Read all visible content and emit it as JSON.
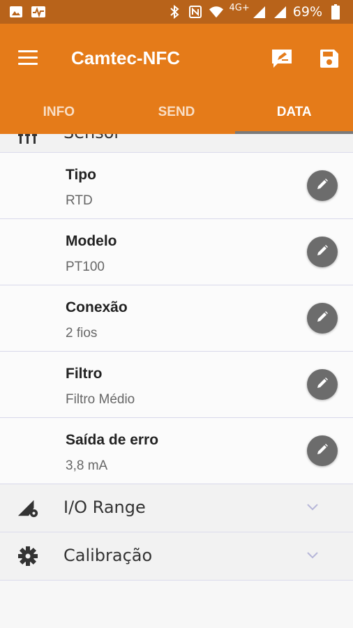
{
  "status_bar": {
    "network": "4G+",
    "battery": "69%",
    "icons": [
      "photo-icon",
      "activity-icon",
      "bluetooth-icon",
      "nfc-icon",
      "wifi-icon",
      "signal-icon",
      "signal-icon",
      "battery-icon"
    ]
  },
  "app_bar": {
    "title": "Camtec-NFC",
    "menu_icon": "menu-icon",
    "actions": [
      "feedback-icon",
      "save-icon"
    ]
  },
  "tabs": [
    {
      "label": "INFO",
      "active": false
    },
    {
      "label": "SEND",
      "active": false
    },
    {
      "label": "DATA",
      "active": true
    }
  ],
  "sections": {
    "sensor": {
      "label": "Sensor",
      "icon": "tune-icon"
    },
    "io_range": {
      "label": "I/O Range",
      "icon": "signal-settings-icon"
    },
    "calibration": {
      "label": "Calibração",
      "icon": "gear-icon"
    }
  },
  "items": [
    {
      "title": "Tipo",
      "value": "RTD"
    },
    {
      "title": "Modelo",
      "value": "PT100"
    },
    {
      "title": "Conexão",
      "value": "2 fios"
    },
    {
      "title": "Filtro",
      "value": "Filtro Médio"
    },
    {
      "title": "Saída de erro",
      "value": "3,8 mA"
    }
  ],
  "colors": {
    "status_bar": "#b8631a",
    "app_bar": "#e57b19",
    "tab_indicator": "#7a7a7a",
    "edit_button": "#6c6c6c"
  }
}
